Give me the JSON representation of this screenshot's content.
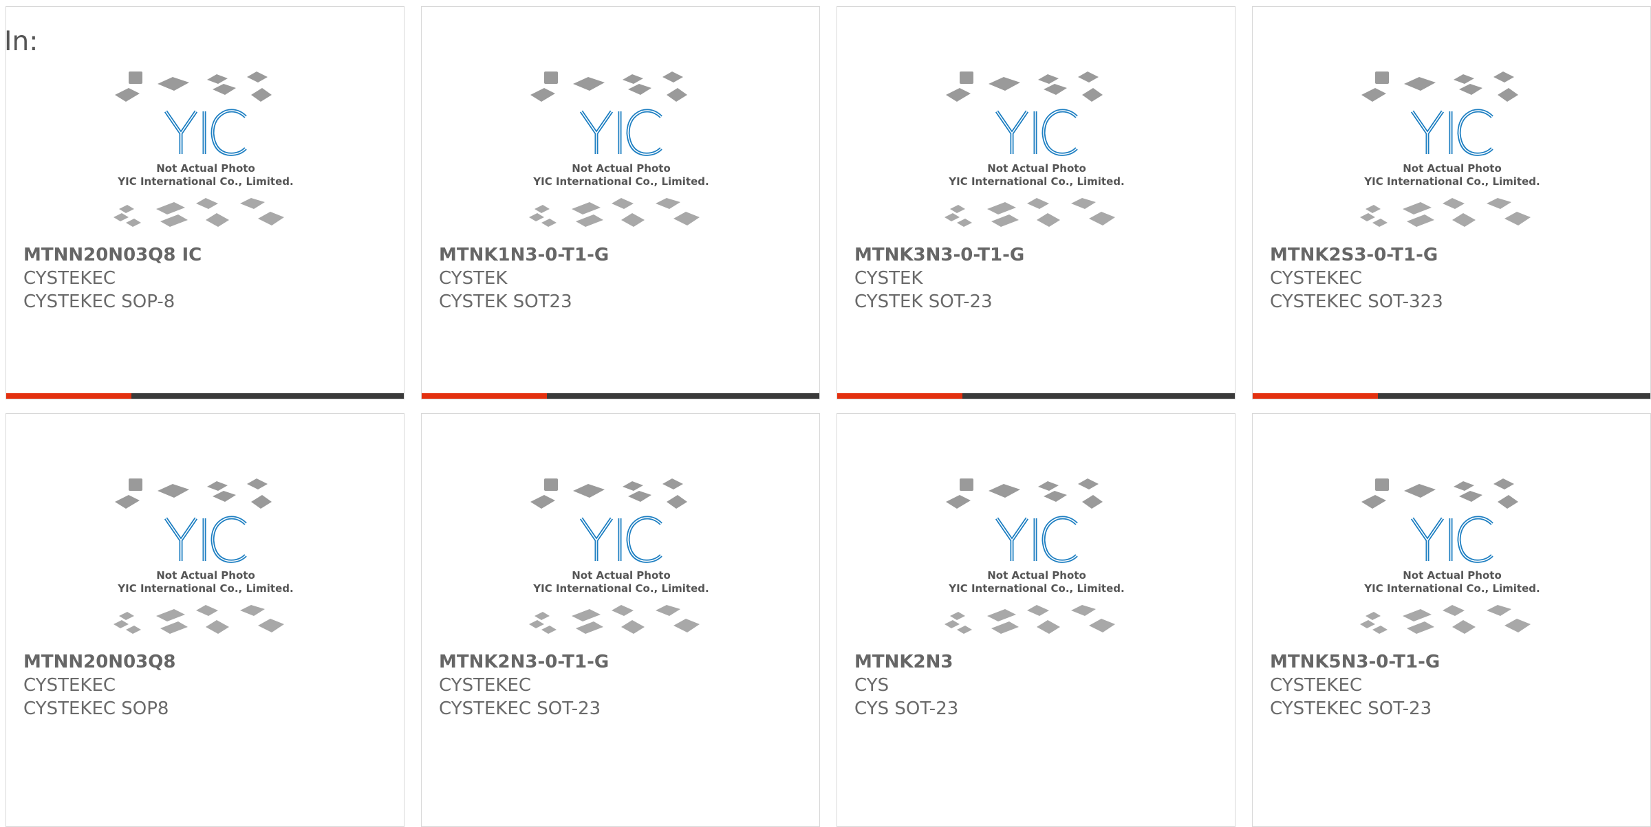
{
  "page": {
    "in_label": "In:"
  },
  "photo": {
    "caption_line1": "Not Actual Photo",
    "caption_line2": "YIC International Co., Limited.",
    "logo_text": "YIC"
  },
  "colors": {
    "accent": "#e3300f",
    "bar_dark": "#3a3a3a",
    "text": "#666666",
    "logo_blue": "#1e7fc2"
  },
  "products": [
    {
      "part": "MTNN20N03Q8 IC",
      "brand": "CYSTEKEC",
      "package": "CYSTEKEC SOP-8"
    },
    {
      "part": "MTNK1N3-0-T1-G",
      "brand": "CYSTEK",
      "package": "CYSTEK SOT23"
    },
    {
      "part": "MTNK3N3-0-T1-G",
      "brand": "CYSTEK",
      "package": "CYSTEK SOT-23"
    },
    {
      "part": "MTNK2S3-0-T1-G",
      "brand": "CYSTEKEC",
      "package": "CYSTEKEC SOT-323"
    },
    {
      "part": "MTNN20N03Q8",
      "brand": "CYSTEKEC",
      "package": "CYSTEKEC SOP8"
    },
    {
      "part": "MTNK2N3-0-T1-G",
      "brand": "CYSTEKEC",
      "package": "CYSTEKEC SOT-23"
    },
    {
      "part": "MTNK2N3",
      "brand": "CYS",
      "package": "CYS SOT-23"
    },
    {
      "part": "MTNK5N3-0-T1-G",
      "brand": "CYSTEKEC",
      "package": "CYSTEKEC SOT-23"
    }
  ]
}
